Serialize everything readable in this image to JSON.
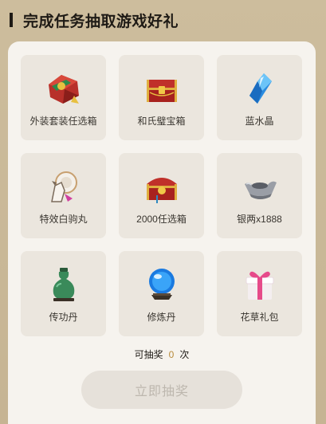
{
  "section": {
    "title": "完成任务抽取游戏好礼"
  },
  "rewards": [
    {
      "label": "外装套装任选箱",
      "icon": "outfit-chest-icon"
    },
    {
      "label": "和氏璧宝箱",
      "icon": "treasure-chest-icon"
    },
    {
      "label": "蓝水晶",
      "icon": "blue-crystal-icon"
    },
    {
      "label": "特效白驹丸",
      "icon": "white-horse-pill-icon"
    },
    {
      "label": "2000任选箱",
      "icon": "selection-chest-icon"
    },
    {
      "label": "银两x1888",
      "icon": "silver-ingot-icon"
    },
    {
      "label": "传功丹",
      "icon": "green-gourd-icon"
    },
    {
      "label": "修炼丹",
      "icon": "blue-orb-icon"
    },
    {
      "label": "花草礼包",
      "icon": "gift-box-icon"
    }
  ],
  "draw": {
    "prefix": "可抽奖",
    "count": "0",
    "suffix": "次",
    "button_label": "立即抽奖"
  },
  "colors": {
    "background": "#c9b898",
    "panel": "#f6f3ee",
    "card": "#ebe6de",
    "count": "#b88a3a",
    "button_disabled": "#e6e1da"
  }
}
